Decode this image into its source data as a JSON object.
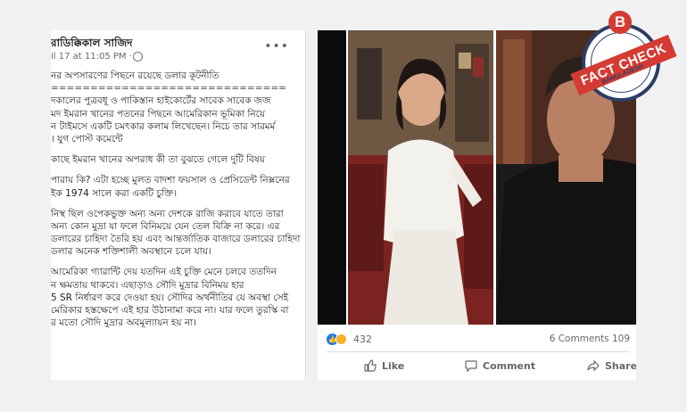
{
  "left_post": {
    "author": "রাডিক্কিকাল সাজিদ",
    "time": "il 17 at 11:05 PM ·",
    "more": "•••",
    "lines": [
      "নর অপসারণের পিছনে রয়েছে ডলার কূটনীতি",
      "==============================",
      "দকালের পুত্রবধূ ও পাকিস্তান হাইকোর্টের সাবেক সাবেক জজ",
      "মদ ইমরান খানের পতনের পিছনে আমেরিকান ভূমিকা নিয়ে",
      "ন টাইমসে একটি চমৎকার কলাম লিখেছেন। নিচে তার সারমর্ম",
      "। যুগ পোস্ট কমেন্টে",
      "",
      "কাছে ইমরান খানের অপরাধ কী তা বুঝতে গেলে দুটি বিষয়",
      "",
      "পারায় কি? এটা হচ্ছে মুলত বাদশা ফয়সাল ও প্রেসিডেন্ট নিক্সনের",
      "ইক 1974 সালে করা একটি চুক্তি।",
      "",
      "নিস্থ ছিল ওপেকভুক্ত অন্য অন্য দেশকে রাজি করাবে যাতে তারা",
      "অন্য কোন মুদ্রা যা ফলে বিনিময়ে যেন তেল বিক্রি না করে। এর",
      "ডলারের চাহিদা তৈরি হয় এবং আন্তর্জাতিক বাজারে ডলারের চাহিদা",
      "ডলার অনেক শক্তিশালী অবস্থানে চলে যায়।",
      "",
      "আমেরিকা গ্যারান্টি দেয় যতদিন এই চুক্তি মেনে চলবে ততদিন",
      "ন ক্ষমতায় থাকবে। এছাড়াও সৌদি মুদ্রার বিনিময় হার",
      "5 SR নির্ধারণ করে দেওয়া হয়। সৌদির অর্থনীতির যে অবস্থা সেই",
      "মেরিকার হস্তক্ষেপে এই হার উঠানামা করে না। যার ফলে তুরস্কি বা",
      "র মতো সৌদি মুদ্রার অবমূল্যায়ন হয় না।"
    ]
  },
  "right_post": {
    "reaction_count": "432",
    "comments": "6 Comments 109",
    "actions": {
      "like": "Like",
      "comment": "Comment",
      "share": "Share"
    }
  },
  "badge": {
    "letter": "B",
    "ribbon": "FACT CHECK",
    "bottom": "BANGLADESH"
  }
}
